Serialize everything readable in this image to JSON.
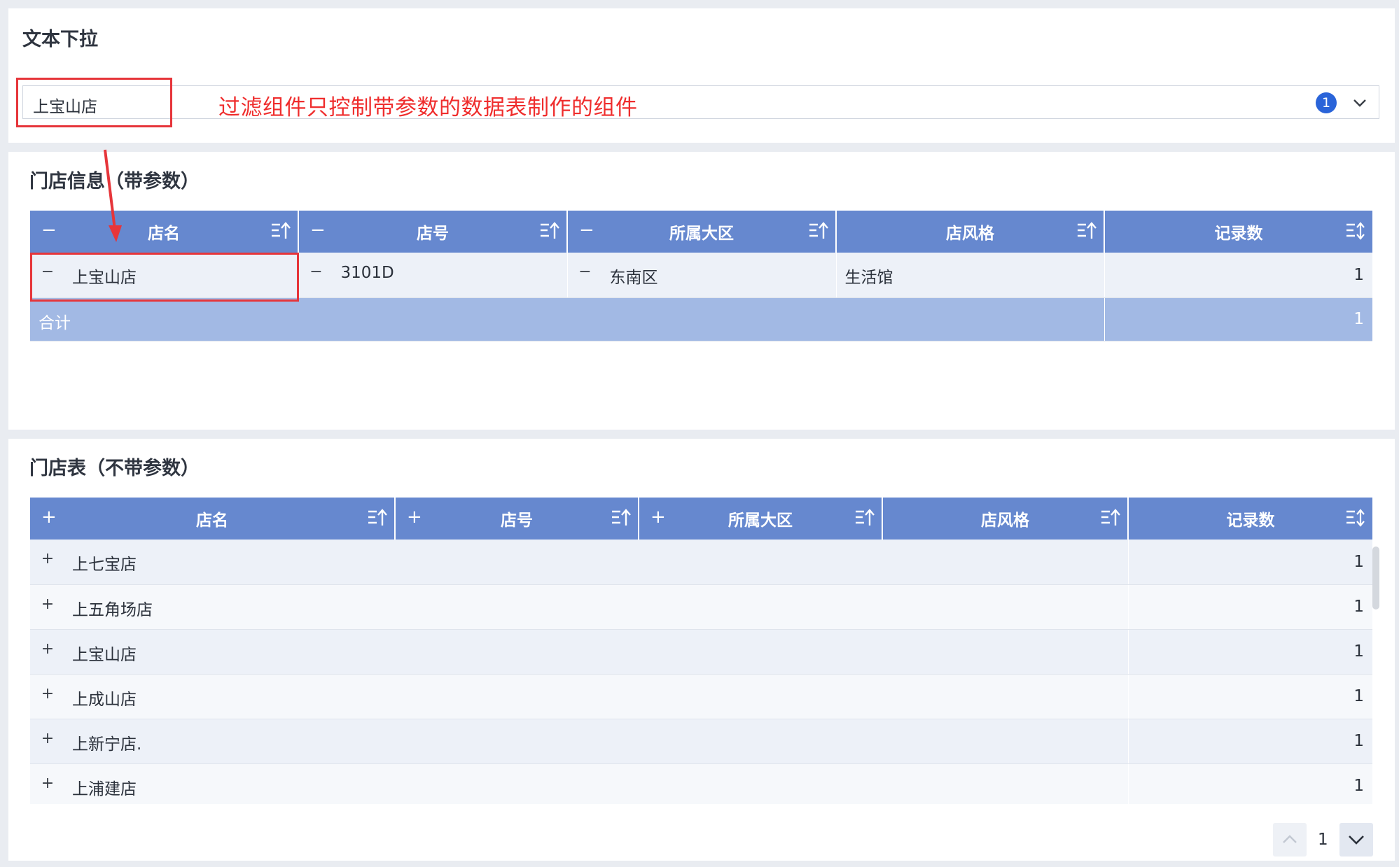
{
  "filter": {
    "title": "文本下拉",
    "selected_value": "上宝山店",
    "selected_count": "1",
    "annotation": "过滤组件只控制带参数的数据表制作的组件"
  },
  "table1": {
    "title": "门店信息（带参数）",
    "headers": [
      {
        "label": "店名",
        "pm": "−"
      },
      {
        "label": "店号",
        "pm": "−"
      },
      {
        "label": "所属大区",
        "pm": "−"
      },
      {
        "label": "店风格",
        "pm": ""
      },
      {
        "label": "记录数",
        "pm": ""
      }
    ],
    "row": {
      "store": "上宝山店",
      "store_no": "3101D",
      "region": "东南区",
      "style": "生活馆",
      "count": "1"
    },
    "total": {
      "label": "合计",
      "count": "1"
    }
  },
  "table2": {
    "title": "门店表（不带参数）",
    "headers": [
      {
        "label": "店名",
        "pm": "+"
      },
      {
        "label": "店号",
        "pm": "+"
      },
      {
        "label": "所属大区",
        "pm": "+"
      },
      {
        "label": "店风格",
        "pm": ""
      },
      {
        "label": "记录数",
        "pm": ""
      }
    ],
    "rows": [
      {
        "store": "上七宝店",
        "count": "1"
      },
      {
        "store": "上五角场店",
        "count": "1"
      },
      {
        "store": "上宝山店",
        "count": "1"
      },
      {
        "store": "上成山店",
        "count": "1"
      },
      {
        "store": "上新宁店.",
        "count": "1"
      },
      {
        "store": "上浦建店",
        "count": "1"
      }
    ]
  },
  "pager": {
    "page": "1"
  },
  "colors": {
    "header": "#6688cf",
    "total": "#a2b9e4",
    "annotation": "#ef2d2d",
    "badge": "#2a64d9"
  }
}
